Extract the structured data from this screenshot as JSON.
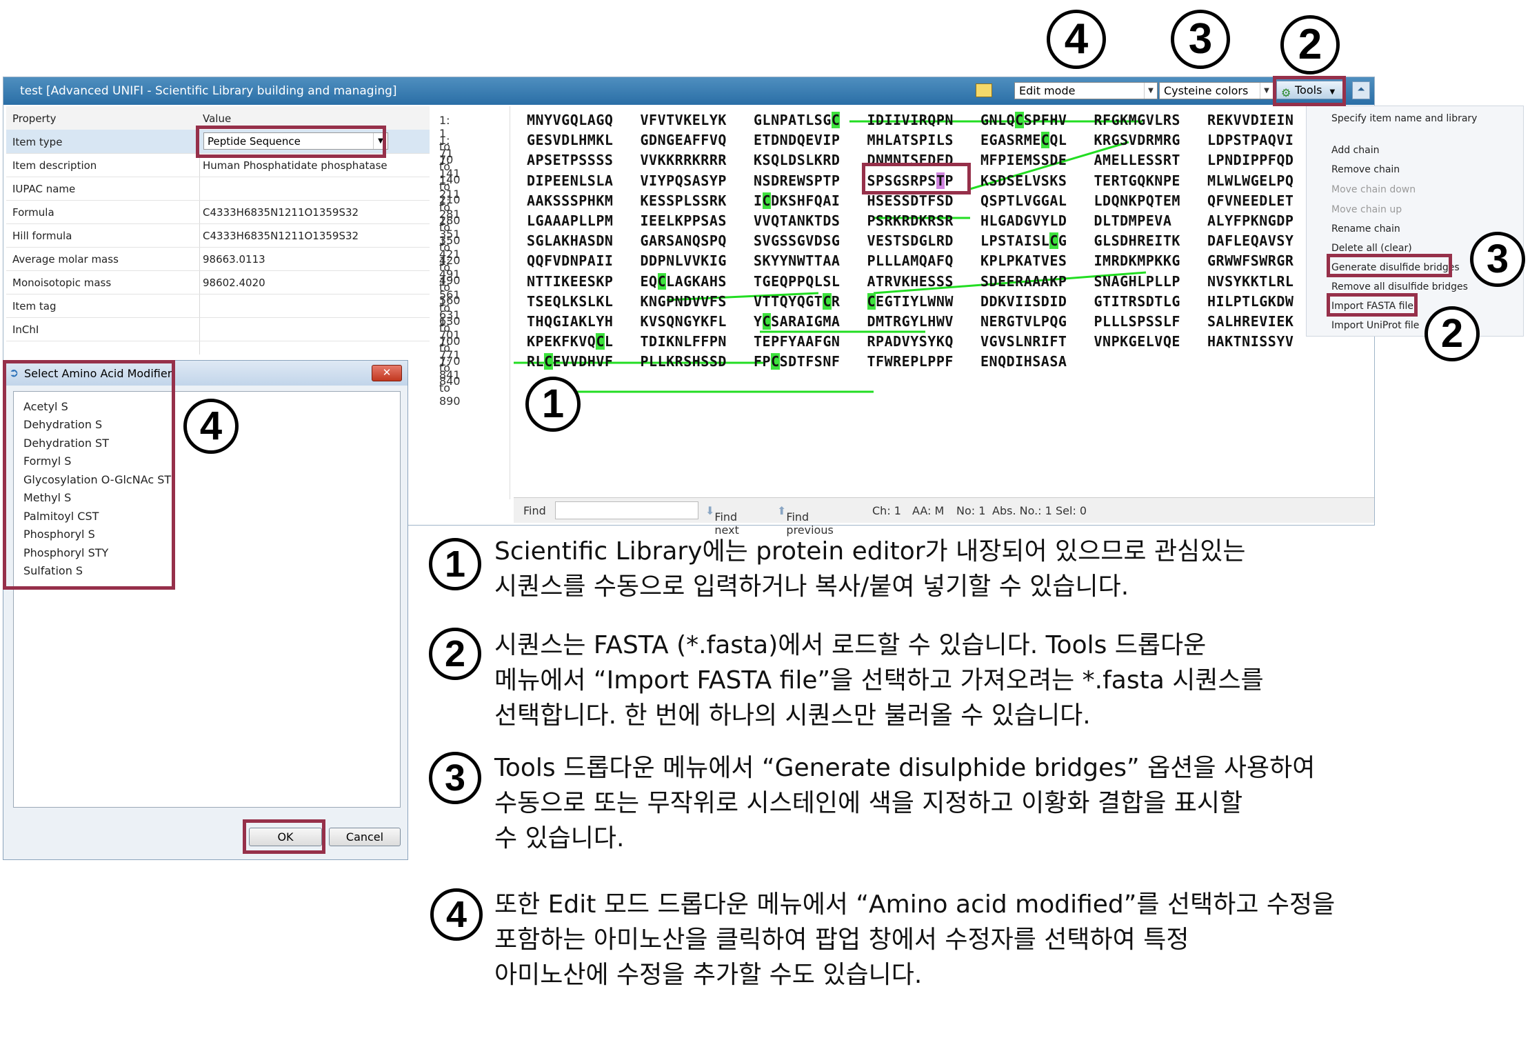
{
  "window": {
    "title": "test  [Advanced UNIFI - Scientific Library building and managing]",
    "edit_mode": "Edit mode",
    "cysteine_colors": "Cysteine colors",
    "tools_label": "Tools"
  },
  "property_grid": {
    "header_property": "Property",
    "header_value": "Value",
    "rows": [
      {
        "key": "Item type",
        "value": "Peptide Sequence"
      },
      {
        "key": "Item description",
        "value": "Human Phosphatidate phosphatase"
      },
      {
        "key": "IUPAC name",
        "value": ""
      },
      {
        "key": "Formula",
        "value": "C4333H6835N1211O1359S32"
      },
      {
        "key": "Hill formula",
        "value": "C4333H6835N1211O1359S32"
      },
      {
        "key": "Average molar mass",
        "value": "98663.0113"
      },
      {
        "key": "Monoisotopic mass",
        "value": "98602.4020"
      },
      {
        "key": "Item tag",
        "value": ""
      },
      {
        "key": "InChI",
        "value": ""
      }
    ]
  },
  "sequence": {
    "line_labels": [
      "1: 1 to 70",
      "1: 71 to 140",
      "1: 141 to 210",
      "1: 211 to 280",
      "1: 281 to 350",
      "1: 351 to 420",
      "1: 421 to 490",
      "1: 491 to 560",
      "1: 561 to 630",
      "1: 631 to 700",
      "1: 701 to 770",
      "1: 771 to 840",
      "1: 841 to 890"
    ],
    "rows": [
      [
        "MNYVGQLAGQ",
        "VFVTVKELYK",
        "GLNPATLSGC",
        "IDIIVIRQPN",
        "GNLQCSPFHV",
        "RFGKMGVLRS",
        "REKVVDIEIN"
      ],
      [
        "GESVDLHMKL",
        "GDNGEAFFVQ",
        "ETDNDQEVIP",
        "MHLATSPILS",
        "EGASRMECQL",
        "KRGSVDRMRG",
        "LDPSTPAQVI"
      ],
      [
        "APSETPSSSS",
        "VVKKRRKRRR",
        "KSQLDSLKRD",
        "DNMNTSEDED",
        "MFPIEMSSDE",
        "AMELLESSRT",
        "LPNDIPPFQD"
      ],
      [
        "DIPEENLSLA",
        "VIYPQSASYP",
        "NSDREWSPTP",
        "SPSGSRPSTP",
        "KSDSELVSKS",
        "TERTGQKNPE",
        "MLWLWGELPQ"
      ],
      [
        "AAKSSSPHKM",
        "KESSPLSSRK",
        "ICDKSHFQAI",
        "HSESSDTFSD",
        "QSPTLVGGAL",
        "LDQNKPQTEM",
        "QFVNEEDLET"
      ],
      [
        "LGAAAPLLPM",
        "IEELKPPSAS",
        "VVQTANKTDS",
        "PSRKRDKRSR",
        "HLGADGVYLD",
        "DLTDMPEVA",
        "ALYFPKNGDP"
      ],
      [
        "SGLAKHASDN",
        "GARSANQSPQ",
        "SVGSSGVDSG",
        "VESTSDGLRD",
        "LPSTAISLCG",
        "GLSDHREITK",
        "DAFLEQAVSY"
      ],
      [
        "QQFVDNPAII",
        "DDPNLVVKIG",
        "SKYYNWTTAA",
        "PLLLAMQAFQ",
        "KPLPKATVES",
        "IMRDKMPKKG",
        "GRWWFSWRGR"
      ],
      [
        "NTTIKEESKP",
        "EQCLAGKAHS",
        "TGEQPPQLSL",
        "ATRVKHESSS",
        "SDEERAAAKP",
        "SNAGHLPLLP",
        "NVSYKKTLRL"
      ],
      [
        "TSEQLKSLKL",
        "KNGPNDVVFS",
        "VTTQYQGTCR",
        "CEGTIYLWNW",
        "DDKVIISDID",
        "GTITRSDTLG",
        "HILPTLGKDW"
      ],
      [
        "THQGIAKLYH",
        "KVSQNGYKFL",
        "YCSARAIGMA",
        "DMTRGYLHWV",
        "NERGTVLPQG",
        "PLLLSPSSLF",
        "SALHREVIEK"
      ],
      [
        "KPEKFKVQCL",
        "TDIKNLFFPN",
        "TEPFYAAFGN",
        "RPADVYSYKQ",
        "VGVSLNRIFT",
        "VNPKGELVQE",
        "HAKTNISSYV"
      ],
      [
        "RLCEVVDHVF",
        "PLLKRSHSSD",
        "FPCSDTFSNF",
        "TFWREPLPPF",
        "ENQDIHSASA",
        "",
        ""
      ]
    ]
  },
  "statusbar": {
    "find_label": "Find",
    "find_next": "Find next",
    "find_previous": "Find previous",
    "ch": "Ch: 1",
    "aa": "AA: M",
    "no": "No: 1",
    "abs_no": "Abs. No.: 1",
    "sel": "Sel: 0"
  },
  "tools_menu": {
    "items": [
      "Specify item name and library",
      "Add chain",
      "Remove chain",
      "Move chain down",
      "Move chain up",
      "Rename chain",
      "Delete all (clear)",
      "Generate disulfide bridges",
      "Remove all disulfide bridges",
      "Import FASTA file",
      "Import UniProt file"
    ]
  },
  "modifier_dialog": {
    "title": "Select Amino Acid Modifier",
    "items": [
      "Acetyl S",
      "Dehydration S",
      "Dehydration ST",
      "Formyl S",
      "Glycosylation O-GlcNAc ST",
      "Methyl S",
      "Palmitoyl CST",
      "Phosphoryl S",
      "Phosphoryl STY",
      "Sulfation S"
    ],
    "ok": "OK",
    "cancel": "Cancel",
    "close": "✕"
  },
  "callouts": {
    "c1": "1",
    "c2": "2",
    "c3": "3",
    "c4": "4"
  },
  "explanations": [
    {
      "num": "1",
      "lines": [
        "Scientific Library에는 protein editor가 내장되어 있으므로 관심있는",
        "시퀀스를 수동으로 입력하거나 복사/붙여 넣기할 수 있습니다."
      ]
    },
    {
      "num": "2",
      "lines": [
        "시퀀스는 FASTA (*.fasta)에서 로드할 수 있습니다. Tools 드롭다운",
        "메뉴에서 “Import FASTA file”을 선택하고 가져오려는 *.fasta 시퀀스를",
        "선택합니다. 한 번에 하나의 시퀀스만 불러올 수 있습니다."
      ]
    },
    {
      "num": "3",
      "lines": [
        "Tools 드롭다운 메뉴에서 “Generate disulphide bridges” 옵션을 사용하여",
        "수동으로 또는 무작위로 시스테인에 색을 지정하고 이황화 결합을 표시할",
        "수 있습니다."
      ]
    },
    {
      "num": "4",
      "lines": [
        "또한 Edit 모드 드롭다운 메뉴에서 “Amino acid modified”를 선택하고 수정을",
        "포함하는 아미노산을 클릭하여 팝업 창에서 수정자를 선택하여 특정",
        "아미노산에 수정을 추가할 수도 있습니다."
      ]
    }
  ],
  "colors": {
    "highlight": "#96304a",
    "cysteine": "#3de23d",
    "bridge": "#22dd22",
    "titlebar": "#2a6ea6"
  }
}
